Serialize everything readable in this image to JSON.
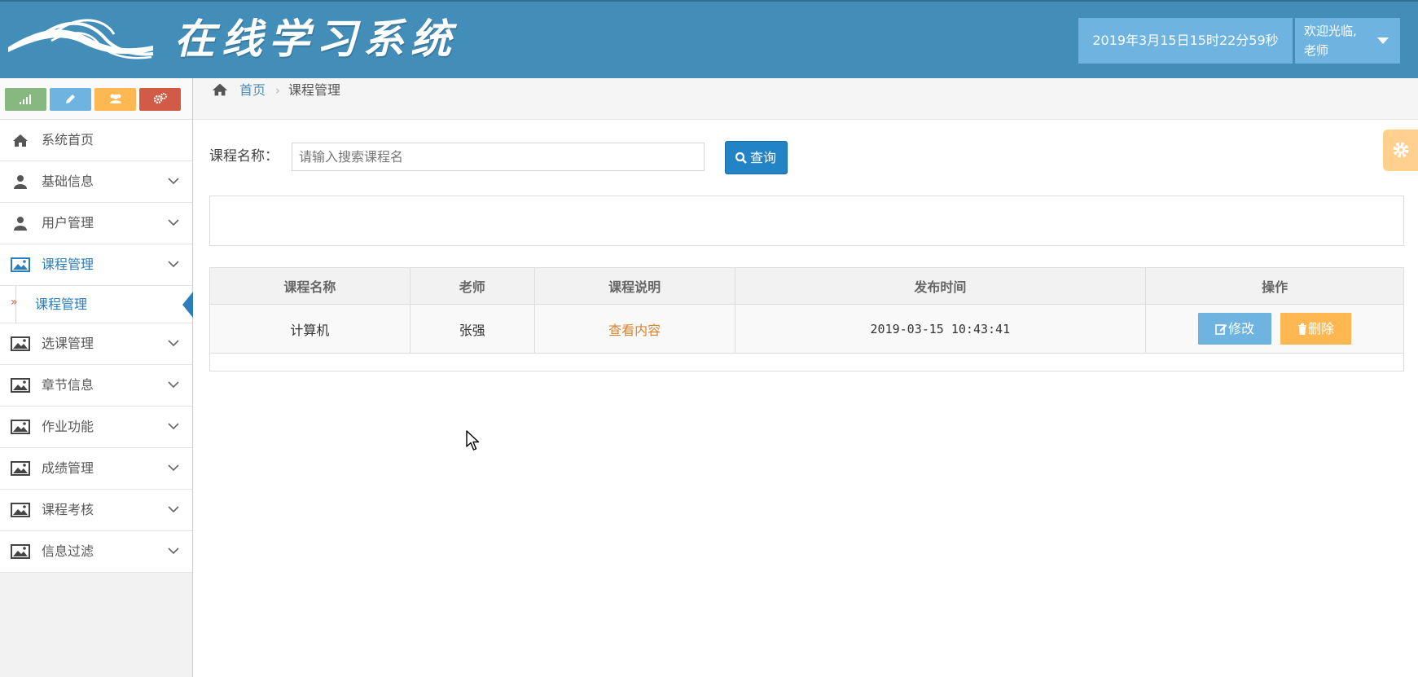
{
  "header": {
    "app_title": "在线学习系统",
    "datetime": "2019年3月15日15时22分59秒",
    "welcome": "欢迎光临,",
    "user_role": "老师"
  },
  "colors": {
    "header_bg": "#438eb9",
    "primary": "#2283c5",
    "edit_btn": "#6fb3e0",
    "delete_btn": "#ffb752",
    "link_orange": "#d8852f"
  },
  "shortcuts": [
    {
      "icon": "signal-icon",
      "color": "#87b87f"
    },
    {
      "icon": "pencil-icon",
      "color": "#6fb3e0"
    },
    {
      "icon": "group-icon",
      "color": "#ffb752"
    },
    {
      "icon": "cogs-icon",
      "color": "#d15b47"
    }
  ],
  "sidebar": {
    "items": [
      {
        "label": "系统首页",
        "icon": "home-icon"
      },
      {
        "label": "基础信息",
        "icon": "user-icon"
      },
      {
        "label": "用户管理",
        "icon": "user-icon"
      },
      {
        "label": "课程管理",
        "icon": "picture-icon"
      },
      {
        "label": "选课管理",
        "icon": "picture-icon"
      },
      {
        "label": "章节信息",
        "icon": "picture-icon"
      },
      {
        "label": "作业功能",
        "icon": "picture-icon"
      },
      {
        "label": "成绩管理",
        "icon": "picture-icon"
      },
      {
        "label": "课程考核",
        "icon": "picture-icon"
      },
      {
        "label": "信息过滤",
        "icon": "picture-icon"
      }
    ],
    "active_sub": "课程管理"
  },
  "breadcrumb": {
    "home": "首页",
    "current": "课程管理"
  },
  "search": {
    "label": "课程名称：",
    "placeholder": "请输入搜索课程名",
    "value": "",
    "button_label": "查询"
  },
  "table": {
    "headers": [
      "课程名称",
      "老师",
      "课程说明",
      "发布时间",
      "操作"
    ],
    "rows": [
      {
        "course_name": "计算机",
        "teacher": "张强",
        "description_link": "查看内容",
        "published": "2019-03-15 10:43:41",
        "edit_label": "修改",
        "delete_label": "删除"
      }
    ]
  }
}
